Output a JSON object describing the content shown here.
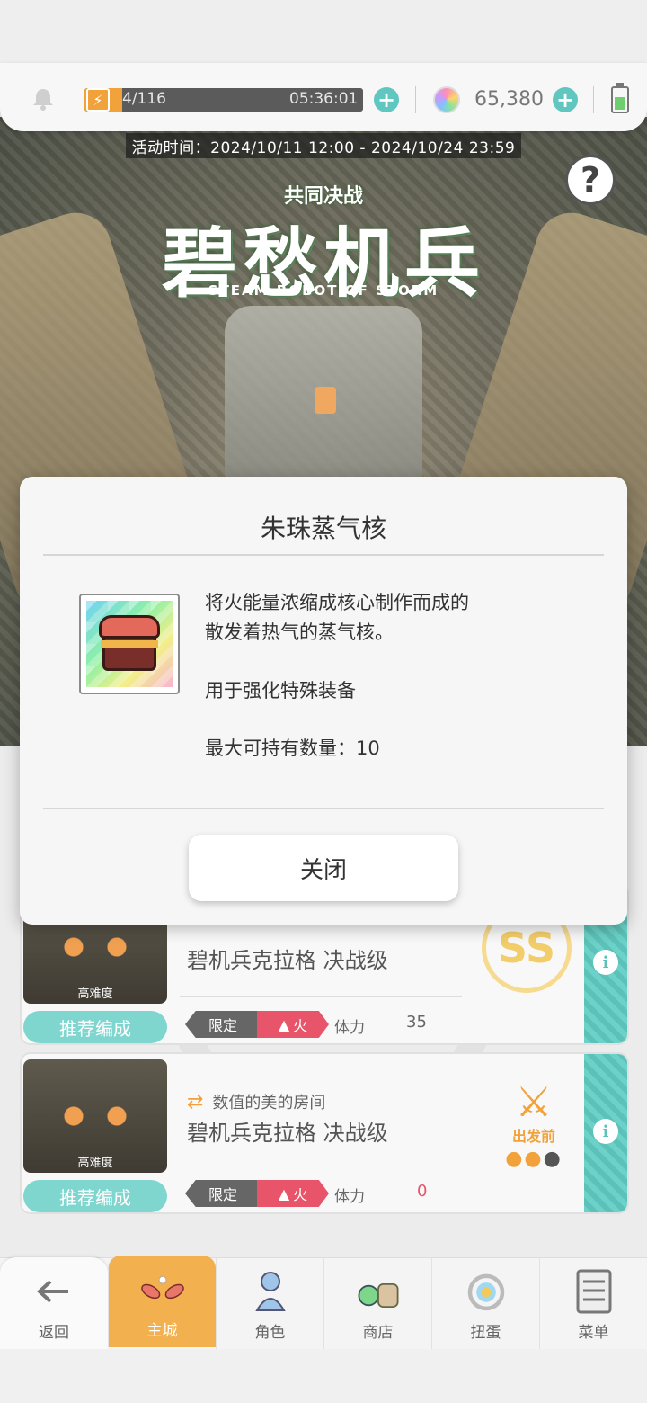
{
  "status": {
    "stamina_current": "4/116",
    "stamina_fraction": 0.034,
    "stamina_timer": "05:36:01",
    "gems": "65,380"
  },
  "event": {
    "time": "活动时间：2024/10/11 12:00 - 2024/10/24 23:59",
    "logo_sub": "共同决战",
    "logo_title": "碧愁机兵",
    "logo_en": "STEAM-ROBOT OF STORM",
    "help_icon": "?"
  },
  "modal": {
    "title": "朱珠蒸气核",
    "desc_line1": "将火能量浓缩成核心制作而成的",
    "desc_line2": "散发着热气的蒸气核。",
    "usage": "用于强化特殊装备",
    "max_hold": "最大可持有数量：10",
    "close_label": "关闭"
  },
  "quests": [
    {
      "thumb_label": "高难度",
      "recommend": "推荐编成",
      "name": "碧机兵克拉格 决战级",
      "tag_limit": "限定",
      "tag_element": "火",
      "stamina_label": "体力",
      "stamina_cost": "35",
      "rank": "SS"
    },
    {
      "thumb_label": "高难度",
      "recommend": "推荐编成",
      "host": "数值的美的房间",
      "name": "碧机兵克拉格 决战级",
      "tag_limit": "限定",
      "tag_element": "火",
      "stamina_label": "体力",
      "stamina_cost": "0",
      "depart": "出发前"
    }
  ],
  "nav": {
    "back": "返回",
    "home": "主城",
    "character": "角色",
    "shop": "商店",
    "gacha": "扭蛋",
    "menu": "菜单"
  },
  "colors": {
    "accent_teal": "#5fc7bf",
    "accent_orange": "#f3b04e",
    "fire_red": "#e8546a",
    "stamina_zero": "#e8546a"
  }
}
